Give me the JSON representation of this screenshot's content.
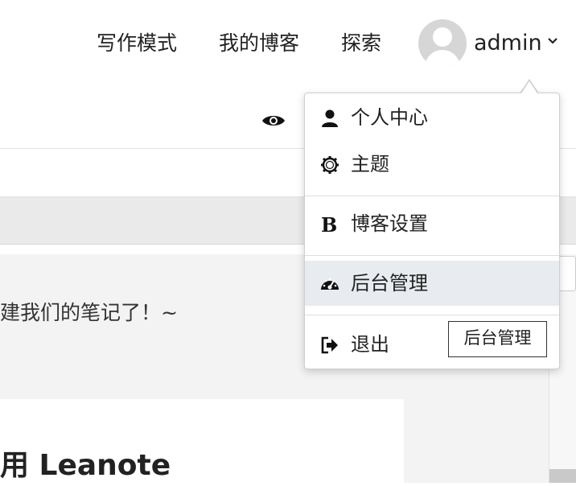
{
  "header": {
    "nav": [
      "写作模式",
      "我的博客",
      "探索"
    ],
    "user_name": "admin"
  },
  "editor": {
    "text_line": "建我们的笔记了！~",
    "heading": "用  Leanote"
  },
  "dropdown": {
    "items": [
      {
        "label": "个人中心",
        "icon": "user-icon"
      },
      {
        "label": "主题",
        "icon": "gear-icon"
      },
      {
        "label": "博客设置",
        "icon": "bold-b-icon"
      },
      {
        "label": "后台管理",
        "icon": "dashboard-icon"
      },
      {
        "label": "退出",
        "icon": "sign-out-icon"
      }
    ],
    "tooltip": "后台管理",
    "active_item": "后台管理"
  },
  "colors": {
    "active_bg": "#e8ecf0",
    "text": "#222222"
  }
}
